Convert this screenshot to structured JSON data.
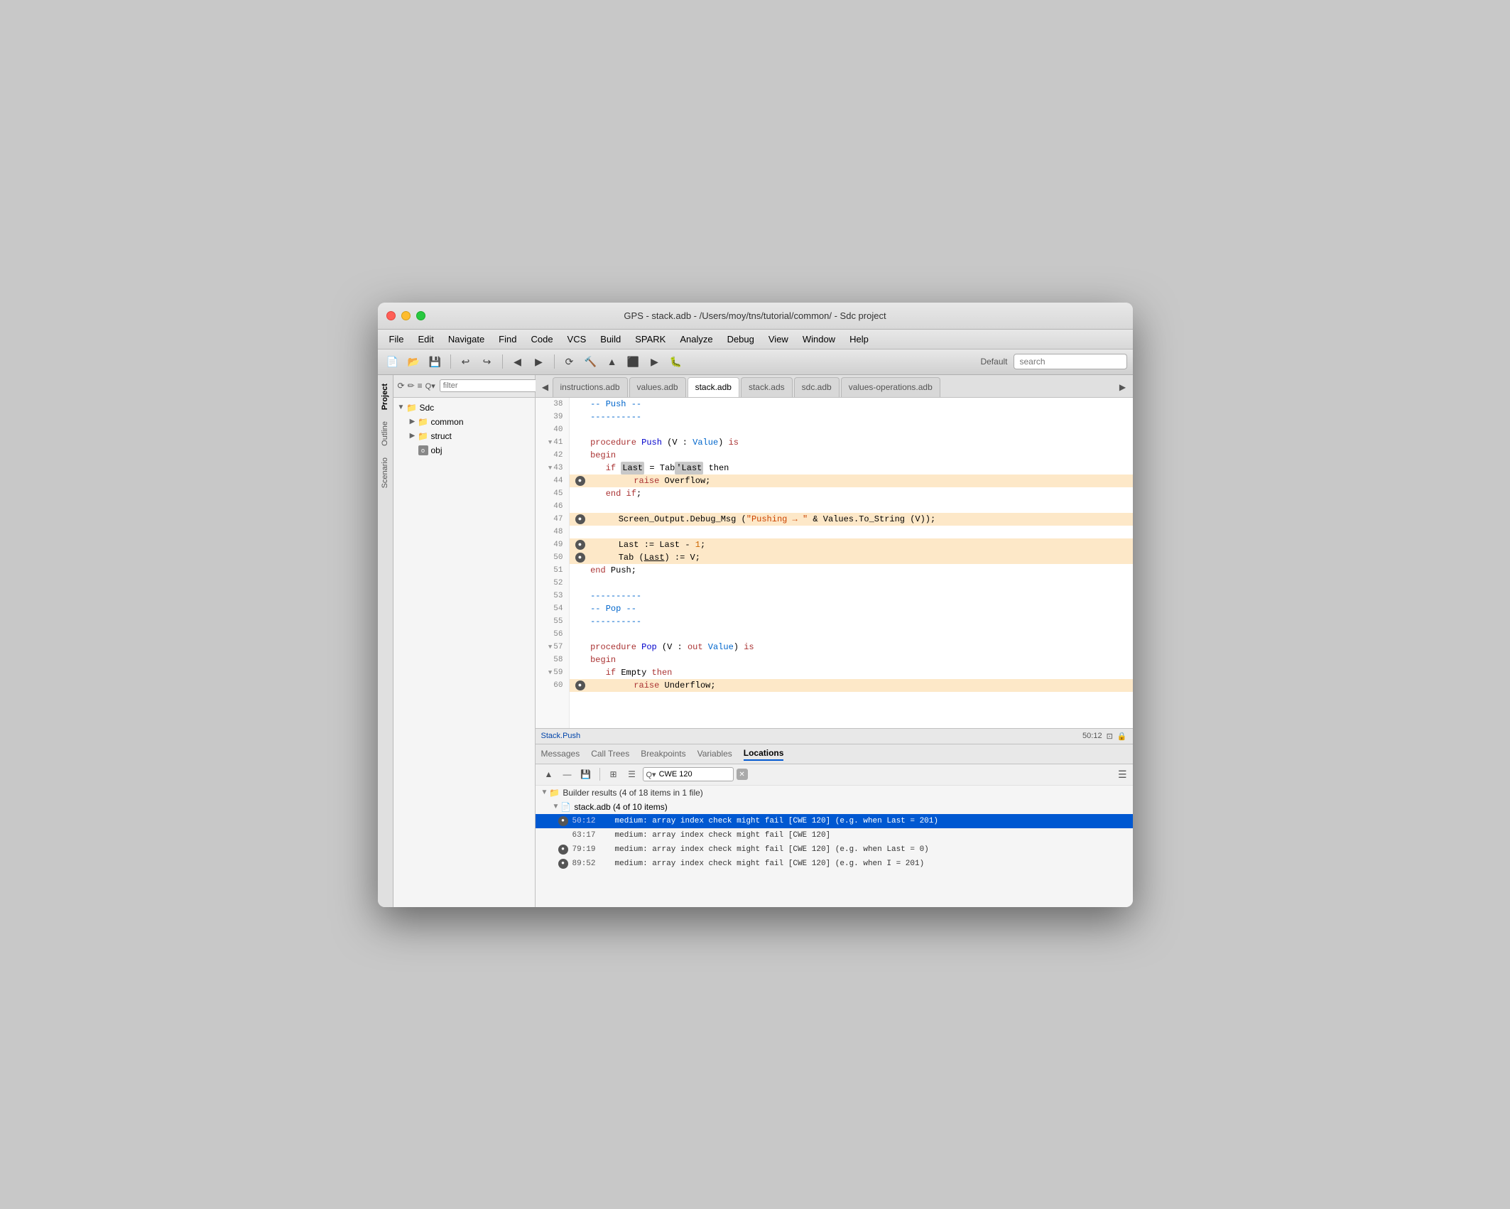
{
  "window": {
    "title": "GPS - stack.adb - /Users/moy/tns/tutorial/common/ - Sdc project",
    "traffic_lights": [
      "close",
      "minimize",
      "maximize"
    ]
  },
  "menu": {
    "items": [
      "File",
      "Edit",
      "Navigate",
      "Find",
      "Code",
      "VCS",
      "Build",
      "SPARK",
      "Analyze",
      "Debug",
      "View",
      "Window",
      "Help"
    ]
  },
  "toolbar": {
    "default_label": "Default",
    "search_placeholder": "search"
  },
  "project_panel": {
    "title": "Project",
    "filter_placeholder": "filter",
    "tree": [
      {
        "label": "Sdc",
        "type": "folder",
        "level": 0,
        "expanded": true
      },
      {
        "label": "common",
        "type": "folder",
        "level": 1,
        "expanded": false
      },
      {
        "label": "struct",
        "type": "folder",
        "level": 1,
        "expanded": false
      },
      {
        "label": "obj",
        "type": "obj",
        "level": 1
      }
    ]
  },
  "side_tabs": [
    "Project",
    "Outline",
    "Scenario"
  ],
  "editor_tabs": [
    {
      "label": "instructions.adb",
      "active": false
    },
    {
      "label": "values.adb",
      "active": false
    },
    {
      "label": "stack.adb",
      "active": true
    },
    {
      "label": "stack.ads",
      "active": false
    },
    {
      "label": "sdc.adb",
      "active": false
    },
    {
      "label": "values-operations.adb",
      "active": false
    }
  ],
  "code": {
    "lines": [
      {
        "num": 38,
        "indent": 0,
        "tokens": [
          {
            "t": "comment",
            "v": "   -- Push --"
          }
        ],
        "highlighted": false,
        "bp": false
      },
      {
        "num": 39,
        "indent": 0,
        "tokens": [
          {
            "t": "comment",
            "v": "   ----------"
          }
        ],
        "highlighted": false,
        "bp": false
      },
      {
        "num": 40,
        "indent": 0,
        "tokens": [],
        "highlighted": false,
        "bp": false
      },
      {
        "num": 41,
        "indent": 0,
        "chevron": true,
        "tokens": [
          {
            "t": "keyword",
            "v": "   procedure "
          },
          {
            "t": "builtin",
            "v": "Push"
          },
          {
            "t": "plain",
            "v": " (V : "
          },
          {
            "t": "type-name",
            "v": "Value"
          },
          {
            "t": "plain",
            "v": ") "
          },
          {
            "t": "keyword",
            "v": "is"
          }
        ],
        "highlighted": false,
        "bp": false
      },
      {
        "num": 42,
        "indent": 0,
        "tokens": [
          {
            "t": "keyword",
            "v": "   begin"
          }
        ],
        "highlighted": false,
        "bp": false
      },
      {
        "num": 43,
        "indent": 0,
        "chevron": true,
        "tokens": [
          {
            "t": "plain",
            "v": "      "
          },
          {
            "t": "keyword",
            "v": "if "
          },
          {
            "t": "plain",
            "v": "Last"
          },
          {
            "t": "plain",
            "v": " = Tab"
          },
          {
            "t": "plain",
            "v": "'Last then"
          }
        ],
        "highlighted": false,
        "bp": false
      },
      {
        "num": 44,
        "indent": 0,
        "tokens": [
          {
            "t": "keyword",
            "v": "         raise"
          },
          {
            "t": "plain",
            "v": " Overflow;"
          }
        ],
        "highlighted": true,
        "bp": true
      },
      {
        "num": 45,
        "indent": 0,
        "tokens": [
          {
            "t": "plain",
            "v": "      "
          },
          {
            "t": "keyword",
            "v": "end if"
          },
          {
            "t": "plain",
            "v": ";"
          }
        ],
        "highlighted": false,
        "bp": false
      },
      {
        "num": 46,
        "indent": 0,
        "tokens": [],
        "highlighted": false,
        "bp": false
      },
      {
        "num": 47,
        "indent": 0,
        "tokens": [
          {
            "t": "plain",
            "v": "      Screen_Output.Debug_Msg (\""
          },
          {
            "t": "string",
            "v": "Pushing → "
          },
          {
            "t": "plain",
            "v": "\" & Values.To_String (V));"
          }
        ],
        "highlighted": true,
        "bp": true
      },
      {
        "num": 48,
        "indent": 0,
        "tokens": [],
        "highlighted": false,
        "bp": false
      },
      {
        "num": 49,
        "indent": 0,
        "tokens": [
          {
            "t": "plain",
            "v": "      Last := Last - "
          },
          {
            "t": "number-lit",
            "v": "1"
          },
          {
            "t": "plain",
            "v": ";"
          }
        ],
        "highlighted": true,
        "bp": true
      },
      {
        "num": 50,
        "indent": 0,
        "tokens": [
          {
            "t": "plain",
            "v": "      Tab ("
          },
          {
            "t": "plain",
            "v": "Last"
          },
          {
            "t": "plain",
            "v": ") := V;"
          }
        ],
        "highlighted": true,
        "bp": true
      },
      {
        "num": 51,
        "indent": 0,
        "tokens": [
          {
            "t": "keyword",
            "v": "   end"
          },
          {
            "t": "plain",
            "v": " Push;"
          }
        ],
        "highlighted": false,
        "bp": false
      },
      {
        "num": 52,
        "indent": 0,
        "tokens": [],
        "highlighted": false,
        "bp": false
      },
      {
        "num": 53,
        "indent": 0,
        "tokens": [
          {
            "t": "comment",
            "v": "   ----------"
          }
        ],
        "highlighted": false,
        "bp": false
      },
      {
        "num": 54,
        "indent": 0,
        "tokens": [
          {
            "t": "comment",
            "v": "   -- Pop --"
          }
        ],
        "highlighted": false,
        "bp": false
      },
      {
        "num": 55,
        "indent": 0,
        "tokens": [
          {
            "t": "comment",
            "v": "   ----------"
          }
        ],
        "highlighted": false,
        "bp": false
      },
      {
        "num": 56,
        "indent": 0,
        "tokens": [],
        "highlighted": false,
        "bp": false
      },
      {
        "num": 57,
        "indent": 0,
        "chevron": true,
        "tokens": [
          {
            "t": "keyword",
            "v": "   procedure "
          },
          {
            "t": "builtin",
            "v": "Pop"
          },
          {
            "t": "plain",
            "v": " (V : "
          },
          {
            "t": "keyword",
            "v": "out "
          },
          {
            "t": "type-name",
            "v": "Value"
          },
          {
            "t": "plain",
            "v": ") "
          },
          {
            "t": "keyword",
            "v": "is"
          }
        ],
        "highlighted": false,
        "bp": false
      },
      {
        "num": 58,
        "indent": 0,
        "tokens": [
          {
            "t": "keyword",
            "v": "   begin"
          }
        ],
        "highlighted": false,
        "bp": false
      },
      {
        "num": 59,
        "indent": 0,
        "chevron": true,
        "tokens": [
          {
            "t": "plain",
            "v": "      "
          },
          {
            "t": "keyword",
            "v": "if"
          },
          {
            "t": "plain",
            "v": " Empty "
          },
          {
            "t": "keyword",
            "v": "then"
          }
        ],
        "highlighted": false,
        "bp": false
      },
      {
        "num": 60,
        "indent": 0,
        "tokens": [
          {
            "t": "keyword",
            "v": "         raise"
          },
          {
            "t": "plain",
            "v": " Underflow;"
          }
        ],
        "highlighted": true,
        "bp": true
      }
    ]
  },
  "status_bar": {
    "procedure": "Stack.Push",
    "position": "50:12"
  },
  "bottom_panel": {
    "tabs": [
      "Messages",
      "Call Trees",
      "Breakpoints",
      "Variables",
      "Locations"
    ],
    "active_tab": "Locations",
    "cwe_filter": "CWE 120",
    "results_header": "Builder results (4 of 18 items in 1 file)",
    "file_header": "stack.adb (4 of 10 items)",
    "results": [
      {
        "location": "50:12",
        "message": "medium: array index check might fail [CWE 120] (e.g. when Last = 201)",
        "selected": true,
        "bp": true
      },
      {
        "location": "63:17",
        "message": "medium: array index check might fail [CWE 120]",
        "selected": false,
        "bp": false
      },
      {
        "location": "79:19",
        "message": "medium: array index check might fail [CWE 120] (e.g. when Last = 0)",
        "selected": false,
        "bp": true
      },
      {
        "location": "89:52",
        "message": "medium: array index check might fail [CWE 120] (e.g. when I = 201)",
        "selected": false,
        "bp": true
      }
    ]
  }
}
